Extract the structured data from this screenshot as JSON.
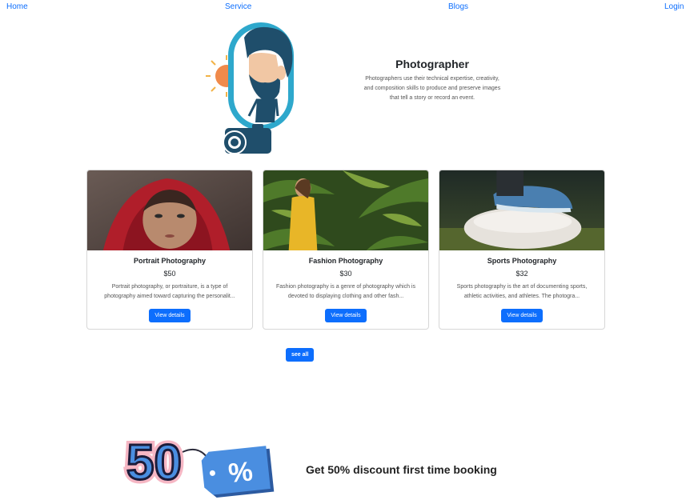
{
  "nav": {
    "home": "Home",
    "service": "Service",
    "blogs": "Blogs",
    "login": "Login"
  },
  "hero": {
    "title": "Photographer",
    "description": "Photographers use their technical expertise, creativity, and composition skills to produce and preserve images that tell a story or record an event."
  },
  "services": [
    {
      "title": "Portrait Photography",
      "price": "$50",
      "description": "Portrait photography, or portraiture, is a type of photography aimed toward capturing the personalit...",
      "button": "View details"
    },
    {
      "title": "Fashion Photography",
      "price": "$30",
      "description": "Fashion photography is a genre of photography which is devoted to displaying clothing and other fash...",
      "button": "View details"
    },
    {
      "title": "Sports Photography",
      "price": "$32",
      "description": "Sports photography is the art of documenting sports, athletic activities, and athletes. The photogra...",
      "button": "View details"
    }
  ],
  "see_all": "see all",
  "discount": {
    "badge_number": "50",
    "badge_symbol": "%",
    "text": "Get 50% discount first time booking"
  },
  "colors": {
    "accent": "#0d6efd",
    "illustration_teal": "#2ea8cc",
    "illustration_navy": "#1f4e6b"
  }
}
